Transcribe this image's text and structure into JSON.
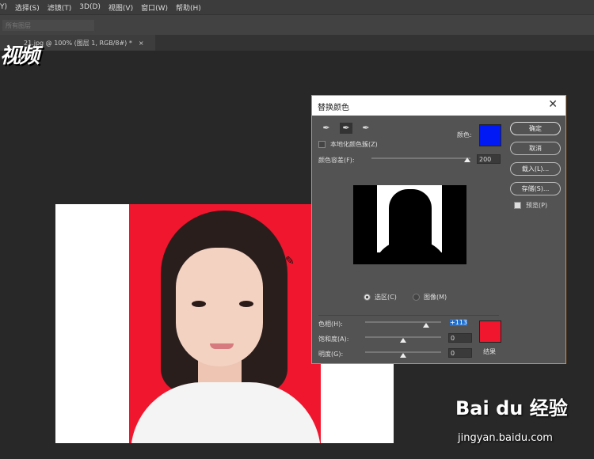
{
  "menu": [
    "Y)",
    "选择(S)",
    "滤镜(T)",
    "3D(D)",
    "视图(V)",
    "窗口(W)",
    "帮助(H)"
  ],
  "options": {
    "layer_select": "所有图层"
  },
  "doc_tab": {
    "label": "21.jpg @ 100% (图层 1, RGB/8#) *",
    "close": "×"
  },
  "brand_text": "视频",
  "dialog": {
    "title": "替换颜色",
    "close": "✕",
    "localized_label": "本地化颜色簇(Z)",
    "localized_checked": false,
    "color_label": "颜色:",
    "color": "#0019f5",
    "fuzziness_label": "颜色容差(F):",
    "fuzziness": "200",
    "buttons": {
      "ok": "确定",
      "cancel": "取消",
      "load": "载入(L)...",
      "save": "存储(S)..."
    },
    "preview_label": "预览(P)",
    "preview_checked": true,
    "radio_selection": "选区(C)",
    "radio_image": "图像(M)",
    "hue_label": "色相(H):",
    "hue": "+113",
    "saturation_label": "饱和度(A):",
    "saturation": "0",
    "lightness_label": "明度(G):",
    "lightness": "0",
    "result_label": "结果",
    "result_color": "#f0162e"
  },
  "watermark": {
    "logo": "Bai du 经验",
    "url": "jingyan.baidu.com"
  }
}
